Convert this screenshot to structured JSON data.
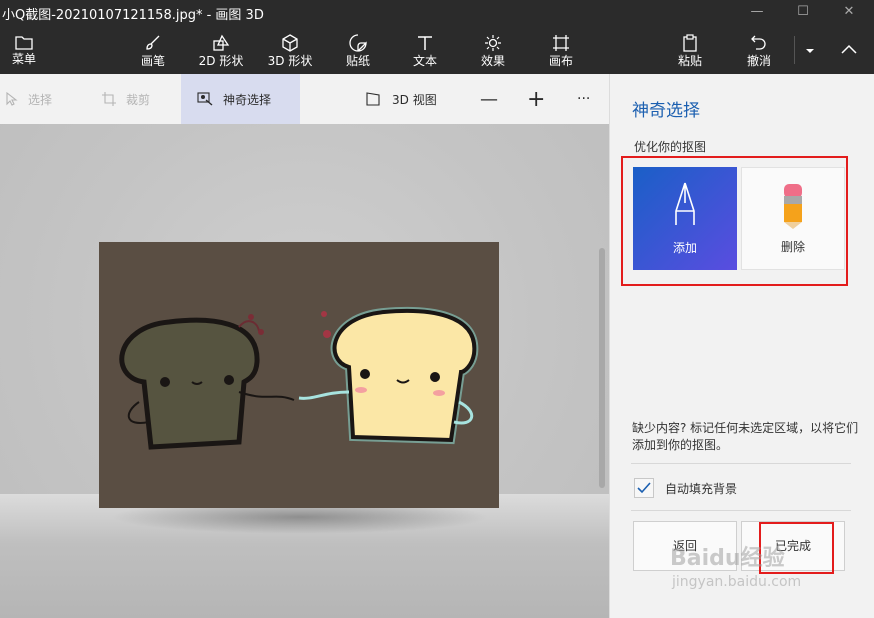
{
  "window": {
    "title": "小Q截图-20210107121158.jpg* - 画图 3D",
    "minimize": "—",
    "maximize": "☐",
    "close": "✕"
  },
  "ribbon": {
    "menu": "菜单",
    "brushes": "画笔",
    "shapes2d": "2D 形状",
    "shapes3d": "3D 形状",
    "stickers": "贴纸",
    "text": "文本",
    "effects": "效果",
    "canvas": "画布",
    "paste": "粘贴",
    "undo": "撤消"
  },
  "toolbar": {
    "select": "选择",
    "crop": "裁剪",
    "magic_select": "神奇选择",
    "view3d": "3D 视图",
    "zoom_out": "—",
    "zoom_in": "+",
    "more": "···"
  },
  "panel": {
    "title": "神奇选择",
    "section": "优化你的抠图",
    "add": "添加",
    "delete": "删除",
    "hint": "缺少内容? 标记任何未选定区域，以将它们添加到你的抠图。",
    "autofill": "自动填充背景",
    "autofill_checked": true,
    "back": "返回",
    "done": "已完成"
  },
  "watermark": {
    "brand": "Baidu经验",
    "url": "jingyan.baidu.com"
  },
  "colors": {
    "accent": "#1b5fb0",
    "highlight_red": "#e31c1c",
    "toolbar_dark": "#2b2b2b"
  }
}
